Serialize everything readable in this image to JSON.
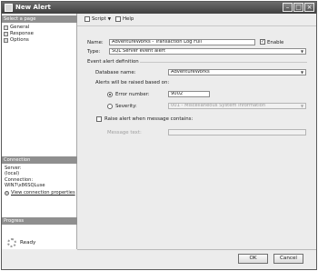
{
  "window": {
    "title": "New Alert"
  },
  "sidebar": {
    "select_page_label": "Select a page",
    "pages": [
      {
        "label": "General"
      },
      {
        "label": "Response"
      },
      {
        "label": "Options"
      }
    ],
    "connection_label": "Connection",
    "server_label": "Server:",
    "server_value": "(local)",
    "connection_field_label": "Connection:",
    "connection_value": "WIN7\\x86SQLuse",
    "view_properties_link": "View connection properties",
    "progress_label": "Progress",
    "progress_status": "Ready"
  },
  "toolbar": {
    "script_label": "Script",
    "help_label": "Help"
  },
  "form": {
    "name_label": "Name:",
    "name_value": "AdventureWorks - Transaction Log Full",
    "enable_label": "Enable",
    "enable_checked": true,
    "type_label": "Type:",
    "type_value": "SQL Server event alert",
    "event_def_label": "Event alert definition",
    "database_label": "Database name:",
    "database_value": "AdventureWorks",
    "raised_label": "Alerts will be raised based on:",
    "error_number_label": "Error number:",
    "error_number_value": "9002",
    "severity_label": "Severity:",
    "severity_value": "001 - Miscellaneous System Information",
    "raise_label": "Raise alert when message contains:",
    "message_text_label": "Message text:",
    "message_text_value": ""
  },
  "buttons": {
    "ok": "OK",
    "cancel": "Cancel"
  }
}
